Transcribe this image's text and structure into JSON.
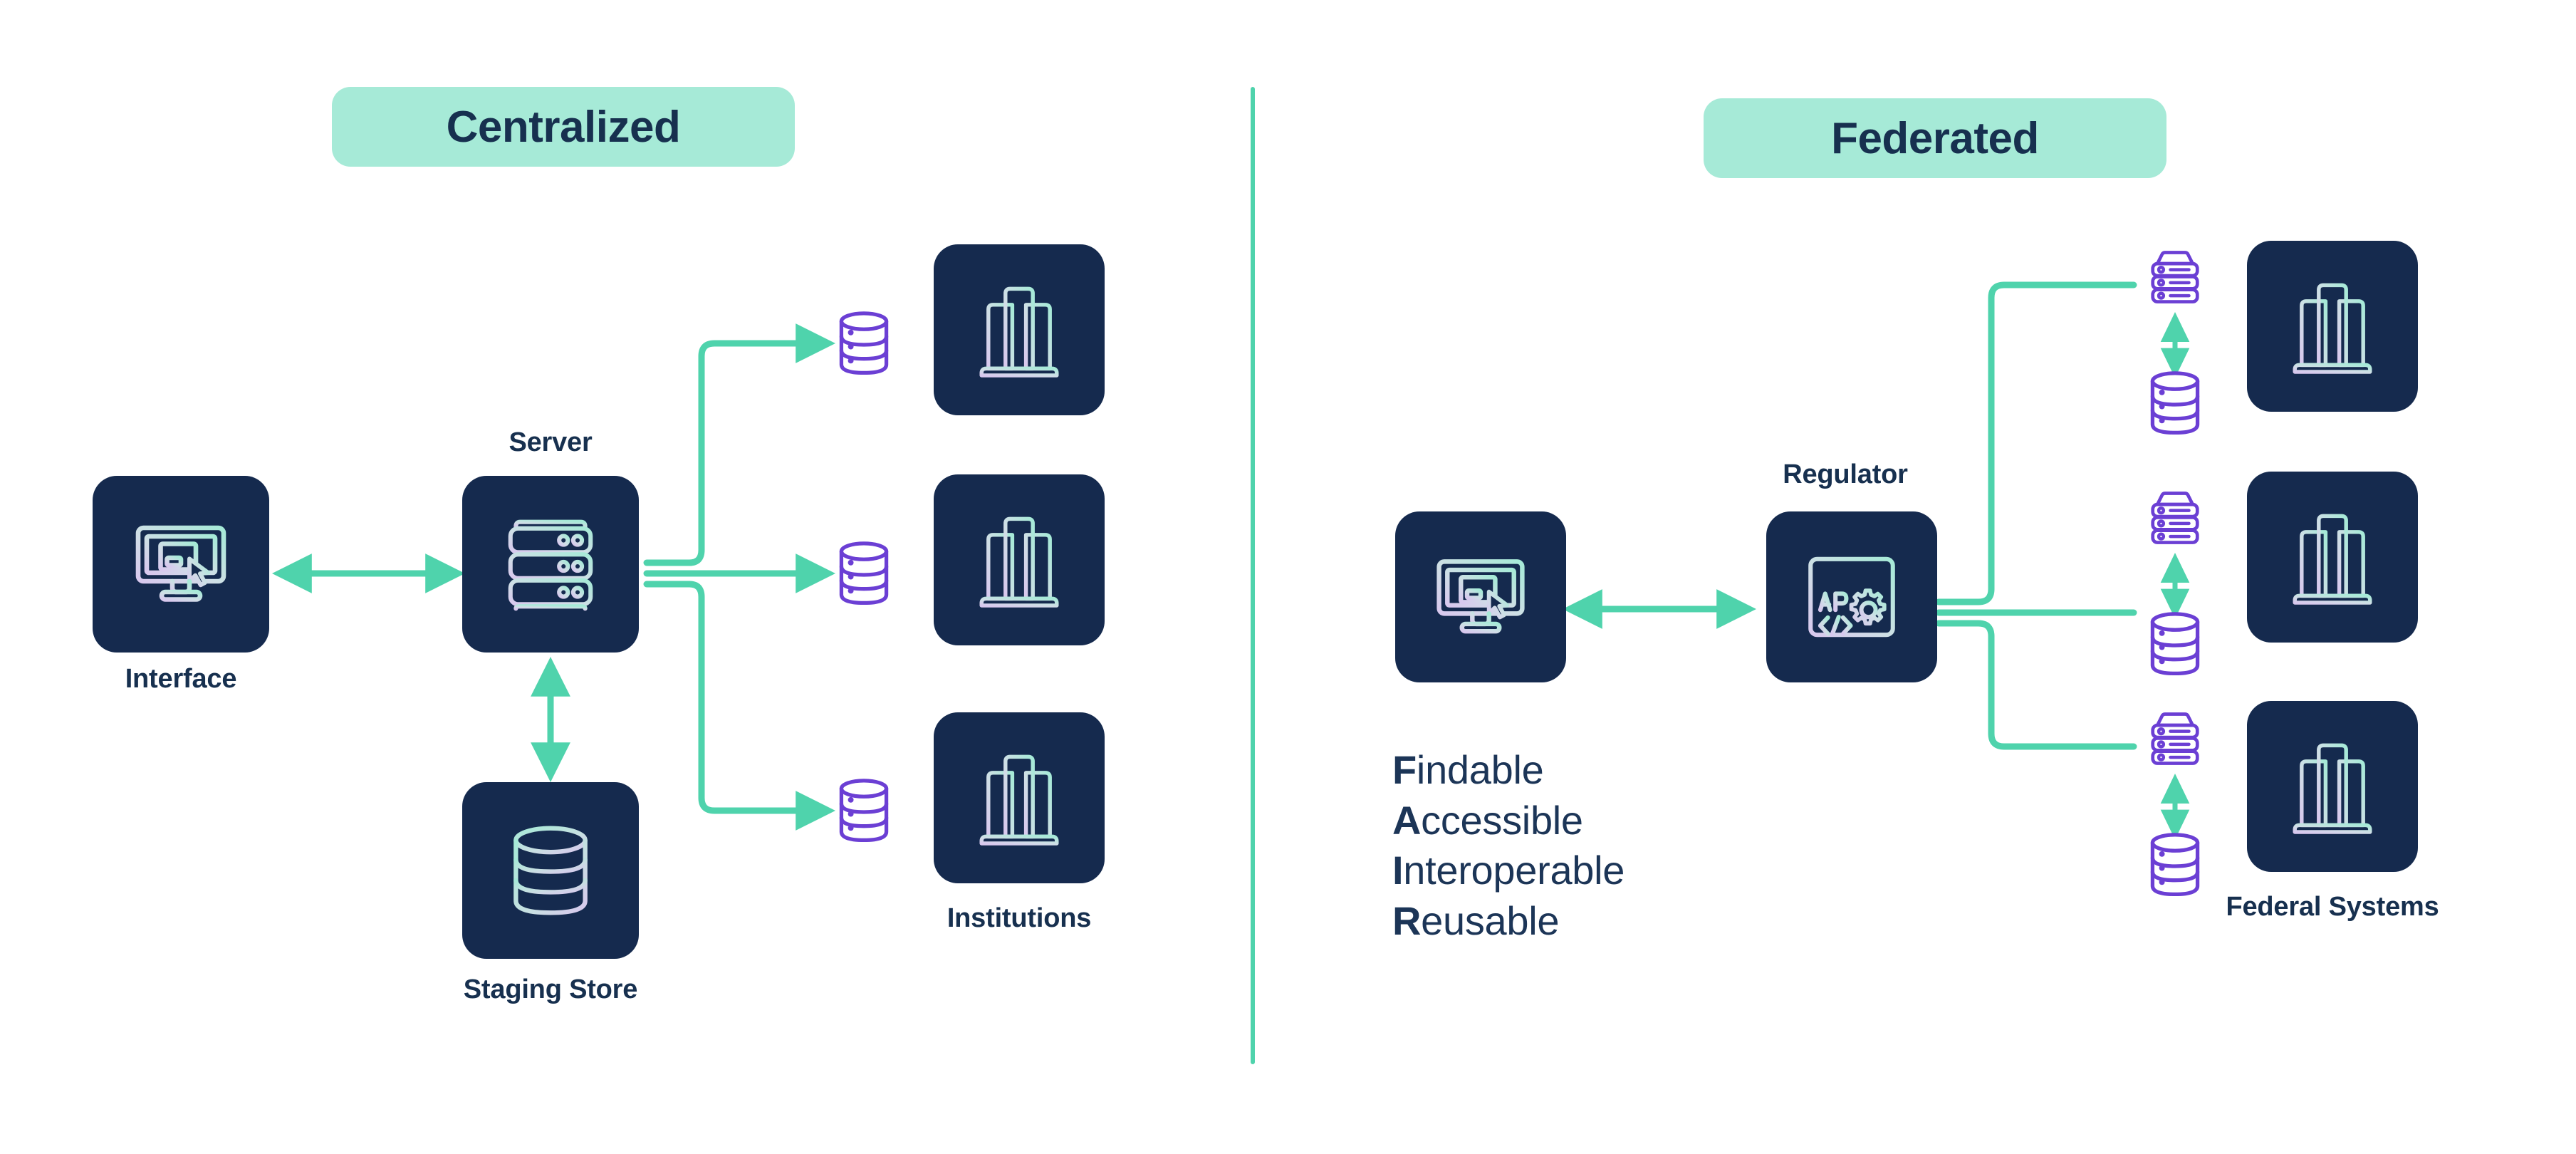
{
  "colors": {
    "navy_tile": "#152a4e",
    "text_navy": "#17304f",
    "mint_badge": "#a6ead7",
    "mint_connector": "#4fd3ac",
    "purple_icon": "#6b3fd4",
    "icon_gradient_start": "#d8c8ee",
    "icon_gradient_end": "#a6ead7",
    "white": "#ffffff"
  },
  "panels": {
    "centralized": {
      "title": "Centralized",
      "nodes": {
        "interface": {
          "label": "Interface",
          "icon": "monitor-cursor-icon"
        },
        "server": {
          "label": "Server",
          "icon": "server-rack-icon"
        },
        "staging_store": {
          "label": "Staging Store",
          "icon": "database-cylinder-icon"
        },
        "institutions": {
          "label": "Institutions",
          "icon": "buildings-icon"
        }
      },
      "database_count": 3,
      "institution_count": 3,
      "connectors": [
        {
          "from": "interface",
          "to": "server",
          "style": "double-arrow",
          "direction": "horizontal"
        },
        {
          "from": "server",
          "to": "staging_store",
          "style": "double-arrow",
          "direction": "vertical"
        },
        {
          "from": "server",
          "to": "database-top",
          "style": "single-arrow",
          "direction": "elbow-up"
        },
        {
          "from": "server",
          "to": "database-middle",
          "style": "single-arrow",
          "direction": "straight"
        },
        {
          "from": "server",
          "to": "database-bottom",
          "style": "single-arrow",
          "direction": "elbow-down"
        }
      ]
    },
    "federated": {
      "title": "Federated",
      "nodes": {
        "interface": {
          "label": "",
          "icon": "monitor-cursor-icon"
        },
        "regulator": {
          "label": "Regulator",
          "icon": "api-gear-window-icon"
        },
        "federal_systems": {
          "label": "Federal Systems",
          "icon": "buildings-icon"
        }
      },
      "node_pair_count": 3,
      "institution_count": 3,
      "node_pair": {
        "server_icon": "server-rack-small-icon",
        "database_icon": "database-cylinder-small-icon",
        "link_style": "double-arrow-vertical"
      },
      "connectors": [
        {
          "from": "interface",
          "to": "regulator",
          "style": "double-arrow",
          "direction": "horizontal"
        },
        {
          "from": "regulator",
          "to": "node-top",
          "style": "plain-line",
          "direction": "elbow-up"
        },
        {
          "from": "regulator",
          "to": "node-middle",
          "style": "plain-line",
          "direction": "straight"
        },
        {
          "from": "regulator",
          "to": "node-bottom",
          "style": "plain-line",
          "direction": "elbow-down"
        }
      ],
      "fair": {
        "lines": [
          {
            "initial": "F",
            "rest": "indable"
          },
          {
            "initial": "A",
            "rest": "ccessible"
          },
          {
            "initial": "I",
            "rest": "nteroperable"
          },
          {
            "initial": "R",
            "rest": "eusable"
          }
        ]
      }
    }
  }
}
